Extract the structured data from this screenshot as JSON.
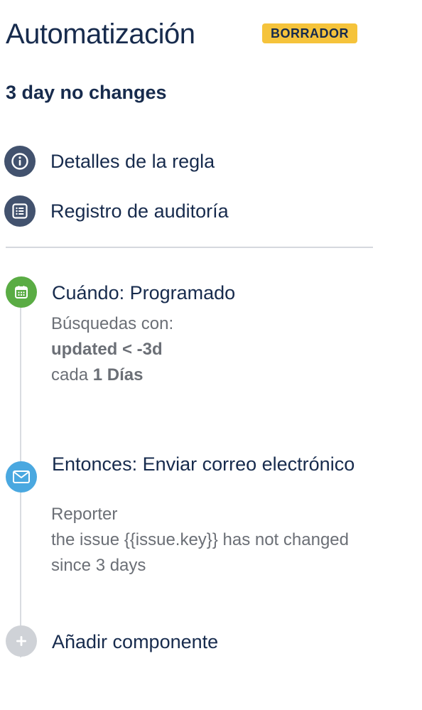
{
  "header": {
    "title": "Automatización",
    "status_badge": "BORRADOR",
    "rule_name": "3 day no changes"
  },
  "nav": {
    "items": [
      {
        "label": "Detalles de la regla",
        "icon": "info-icon"
      },
      {
        "label": "Registro de auditoría",
        "icon": "list-icon"
      }
    ]
  },
  "steps": {
    "trigger": {
      "title": "Cuándo: Programado",
      "icon": "calendar-icon",
      "color": "#5aac44",
      "line1": "Búsquedas con:",
      "jql": "updated < -3d",
      "every_prefix": "cada",
      "every_value": "1 Días"
    },
    "action": {
      "title": "Entonces: Enviar correo electrónico",
      "icon": "email-icon",
      "color": "#4aa8e0",
      "recipient": "Reporter",
      "subject_line1": "the issue {{issue.key}} has not changed",
      "subject_line2": "since 3 days"
    },
    "add": {
      "label": "Añadir componente",
      "icon": "plus-icon",
      "color": "#cfd2d7"
    }
  },
  "colors": {
    "text_primary": "#172b4d",
    "text_secondary": "#6b6f76",
    "badge": "#f5c33b",
    "nav_icon_bg": "#42526e"
  }
}
